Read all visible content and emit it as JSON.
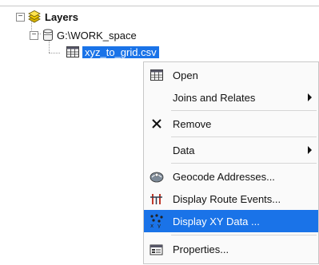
{
  "tree": {
    "root": {
      "expander": "−",
      "label": "Layers",
      "icon": "layers-icon"
    },
    "workspace": {
      "expander": "−",
      "label": "G:\\WORK_space",
      "icon": "folder-database-icon"
    },
    "table": {
      "label": "xyz_to_grid.csv",
      "icon": "table-icon"
    }
  },
  "menu": {
    "items": [
      {
        "label": "Open",
        "icon": "table-icon"
      },
      {
        "label": "Joins and Relates",
        "submenu": true
      },
      {
        "label": "Remove",
        "icon": "remove-x-icon"
      },
      {
        "label": "Data",
        "submenu": true
      },
      {
        "label": "Geocode Addresses...",
        "icon": "geocode-icon"
      },
      {
        "label": "Display Route Events...",
        "icon": "route-events-icon"
      },
      {
        "label": "Display XY Data ...",
        "icon": "xy-data-icon",
        "highlighted": true
      },
      {
        "label": "Properties...",
        "icon": "properties-icon"
      }
    ]
  },
  "colors": {
    "selection": "#1a73e8"
  }
}
